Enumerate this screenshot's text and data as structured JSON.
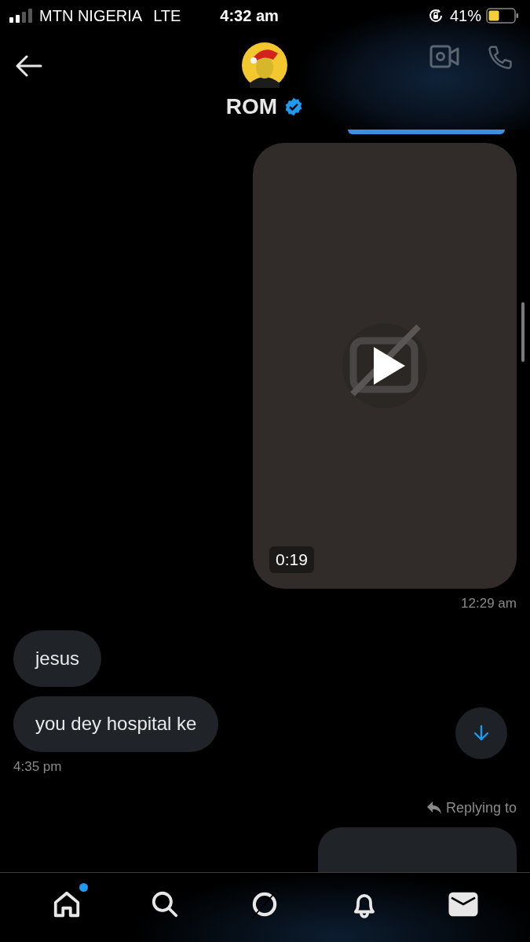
{
  "status_bar": {
    "carrier": "MTN NIGERIA",
    "network": "LTE",
    "time": "4:32 am",
    "battery_percent": "41%"
  },
  "header": {
    "name": "ROM",
    "verified": true
  },
  "messages": [
    {
      "kind": "clipped_bubble",
      "outgoing": true
    },
    {
      "kind": "video",
      "outgoing": true,
      "duration": "0:19"
    },
    {
      "kind": "timestamp",
      "outgoing": true,
      "text": "12:29 am"
    },
    {
      "kind": "text",
      "outgoing": false,
      "text": "jesus"
    },
    {
      "kind": "text",
      "outgoing": false,
      "text": "you dey hospital ke"
    },
    {
      "kind": "timestamp",
      "outgoing": false,
      "text": "4:35 pm"
    },
    {
      "kind": "reply_label",
      "text": "Replying to"
    },
    {
      "kind": "reply_bubble"
    }
  ],
  "tabs": [
    {
      "selected": false,
      "badge": true
    },
    {
      "selected": false,
      "badge": false
    },
    {
      "selected": false,
      "badge": false
    },
    {
      "selected": false,
      "badge": false
    },
    {
      "selected": true,
      "badge": false
    }
  ]
}
